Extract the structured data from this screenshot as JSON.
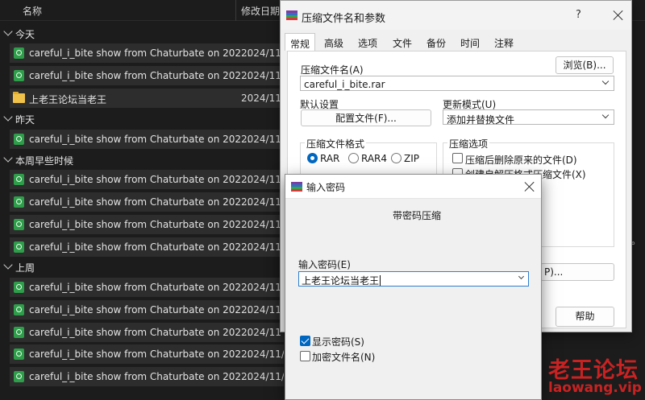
{
  "explorer": {
    "columns": {
      "name": "名称",
      "date": "修改日期"
    },
    "groups": {
      "today": "今天",
      "yesterday": "昨天",
      "this_week_earlier": "本周早些时候",
      "last_week": "上周"
    },
    "files": {
      "today": [
        {
          "name": "careful_i_bite show from Chaturbate on 202...",
          "date": "2024/11",
          "icon": "video-file-icon"
        },
        {
          "name": "careful_i_bite show from Chaturbate on 202...",
          "date": "2024/11",
          "icon": "video-file-icon"
        },
        {
          "name": "上老王论坛当老王",
          "date": "2024/11",
          "icon": "folder-icon"
        }
      ],
      "yesterday": [
        {
          "name": "careful_i_bite show from Chaturbate on 202...",
          "date": "2024/11",
          "icon": "video-file-icon"
        }
      ],
      "this_week_earlier": [
        {
          "name": "careful_i_bite show from Chaturbate on 202...",
          "date": "2024/11",
          "icon": "video-file-icon"
        },
        {
          "name": "careful_i_bite show from Chaturbate on 202...",
          "date": "2024/11",
          "icon": "video-file-icon"
        },
        {
          "name": "careful_i_bite show from Chaturbate on 202...",
          "date": "2024/11",
          "icon": "video-file-icon"
        },
        {
          "name": "careful_i_bite show from Chaturbate on 202...",
          "date": "2024/11",
          "icon": "video-file-icon"
        }
      ],
      "last_week": [
        {
          "name": "careful_i_bite show from Chaturbate on 202...",
          "date": "2024/11",
          "icon": "video-file-icon"
        },
        {
          "name": "careful_i_bite show from Chaturbate on 202...",
          "date": "2024/11",
          "icon": "video-file-icon"
        },
        {
          "name": "careful_i_bite show from Chaturbate on 202...",
          "date": "2024/11",
          "icon": "video-file-icon"
        },
        {
          "name": "careful_i_bite show from Chaturbate on 202...",
          "date": "2024/11/",
          "icon": "video-file-icon"
        },
        {
          "name": "careful_i_bite show from Chaturbate on 202...",
          "date": "2024/11/",
          "icon": "video-file-icon"
        }
      ]
    },
    "side_text": "。"
  },
  "compress_dialog": {
    "title": "压缩文件名和参数",
    "help_glyph": "?",
    "tabs": [
      "常规",
      "高级",
      "选项",
      "文件",
      "备份",
      "时间",
      "注释"
    ],
    "archive_name_label": "压缩文件名(A)",
    "browse_button": "浏览(B)...",
    "archive_name_value": "careful_i_bite.rar",
    "default_settings_label": "默认设置",
    "profiles_button": "配置文件(F)...",
    "update_mode_label": "更新模式(U)",
    "update_mode_value": "添加并替换文件",
    "format_group_label": "压缩文件格式",
    "formats": [
      "RAR",
      "RAR4",
      "ZIP"
    ],
    "selected_format": "RAR",
    "options_group_label": "压缩选项",
    "option_delete_after": "压缩后删除原来的文件(D)",
    "option_sfx": "创建自解压格式压缩文件(X)",
    "partial_button_text": "P)...",
    "help_button": "帮助"
  },
  "password_dialog": {
    "title": "输入密码",
    "subtitle": "带密码压缩",
    "password_label": "输入密码(E)",
    "password_value": "上老王论坛当老王",
    "show_password_label": "显示密码(S)",
    "show_password_checked": true,
    "encrypt_names_label": "加密文件名(N)",
    "encrypt_names_checked": false
  },
  "watermark": {
    "cn": "老王论坛",
    "en": "laowang.vip"
  },
  "colors": {
    "accent": "#0067c0",
    "watermark": "#c92222",
    "file_icon": "#2e9e4a",
    "folder": "#f0c24a"
  }
}
